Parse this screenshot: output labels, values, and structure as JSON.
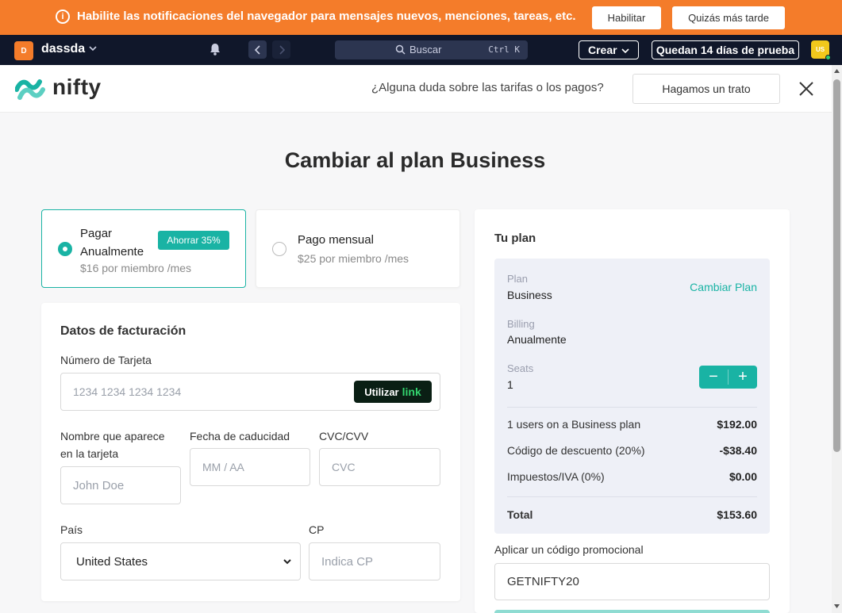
{
  "banner": {
    "text": "Habilite las notificaciones del navegador para mensajes nuevos, menciones, tareas, etc.",
    "enable_label": "Habilitar",
    "later_label": "Quizás más tarde",
    "bg_color": "#f47c2a"
  },
  "topbar": {
    "workspace_initial": "D",
    "workspace_name": "dassda",
    "search_placeholder": "Buscar",
    "search_shortcut": "Ctrl K",
    "create_label": "Crear",
    "trial_label": "Quedan 14 días de prueba",
    "user_initials": "US",
    "bg_color": "#10172a"
  },
  "header": {
    "logo_text": "nifty",
    "question": "¿Alguna duda sobre las tarifas o los pagos?",
    "deal_button": "Hagamos un trato"
  },
  "page_title": "Cambiar al plan Business",
  "plans": {
    "annual": {
      "name": "Pagar Anualmente",
      "badge": "Ahorrar 35%",
      "price": "$16 por miembro /mes",
      "selected": true
    },
    "monthly": {
      "name": "Pago mensual",
      "price": "$25 por miembro /mes",
      "selected": false
    }
  },
  "billing": {
    "title": "Datos de facturación",
    "card_number_label": "Número de Tarjeta",
    "card_number_placeholder": "1234 1234 1234 1234",
    "link_button_prefix": "Utilizar",
    "link_button_brand": "link",
    "name_label": "Nombre que aparece en la tarjeta",
    "name_placeholder": "John Doe",
    "expiry_label": "Fecha de caducidad",
    "expiry_placeholder": "MM / AA",
    "cvc_label": "CVC/CVV",
    "cvc_placeholder": "CVC",
    "country_label": "País",
    "country_value": "United States",
    "zip_label": "CP",
    "zip_placeholder": "Indica CP"
  },
  "summary": {
    "title": "Tu plan",
    "plan_label": "Plan",
    "plan_value": "Business",
    "change_plan": "Cambiar Plan",
    "billing_label": "Billing",
    "billing_value": "Anualmente",
    "seats_label": "Seats",
    "seats_value": "1",
    "stepper_minus": "−",
    "stepper_plus": "+",
    "lines": [
      {
        "label": "1 users on a Business plan",
        "value": "$192.00"
      },
      {
        "label": "Código de descuento (20%)",
        "value": "-$38.40"
      },
      {
        "label": "Impuestos/IVA (0%)",
        "value": "$0.00"
      }
    ],
    "total_label": "Total",
    "total_value": "$153.60",
    "promo_label": "Aplicar un código promocional",
    "promo_value": "GETNIFTY20",
    "accent_color": "#19b3a4"
  }
}
